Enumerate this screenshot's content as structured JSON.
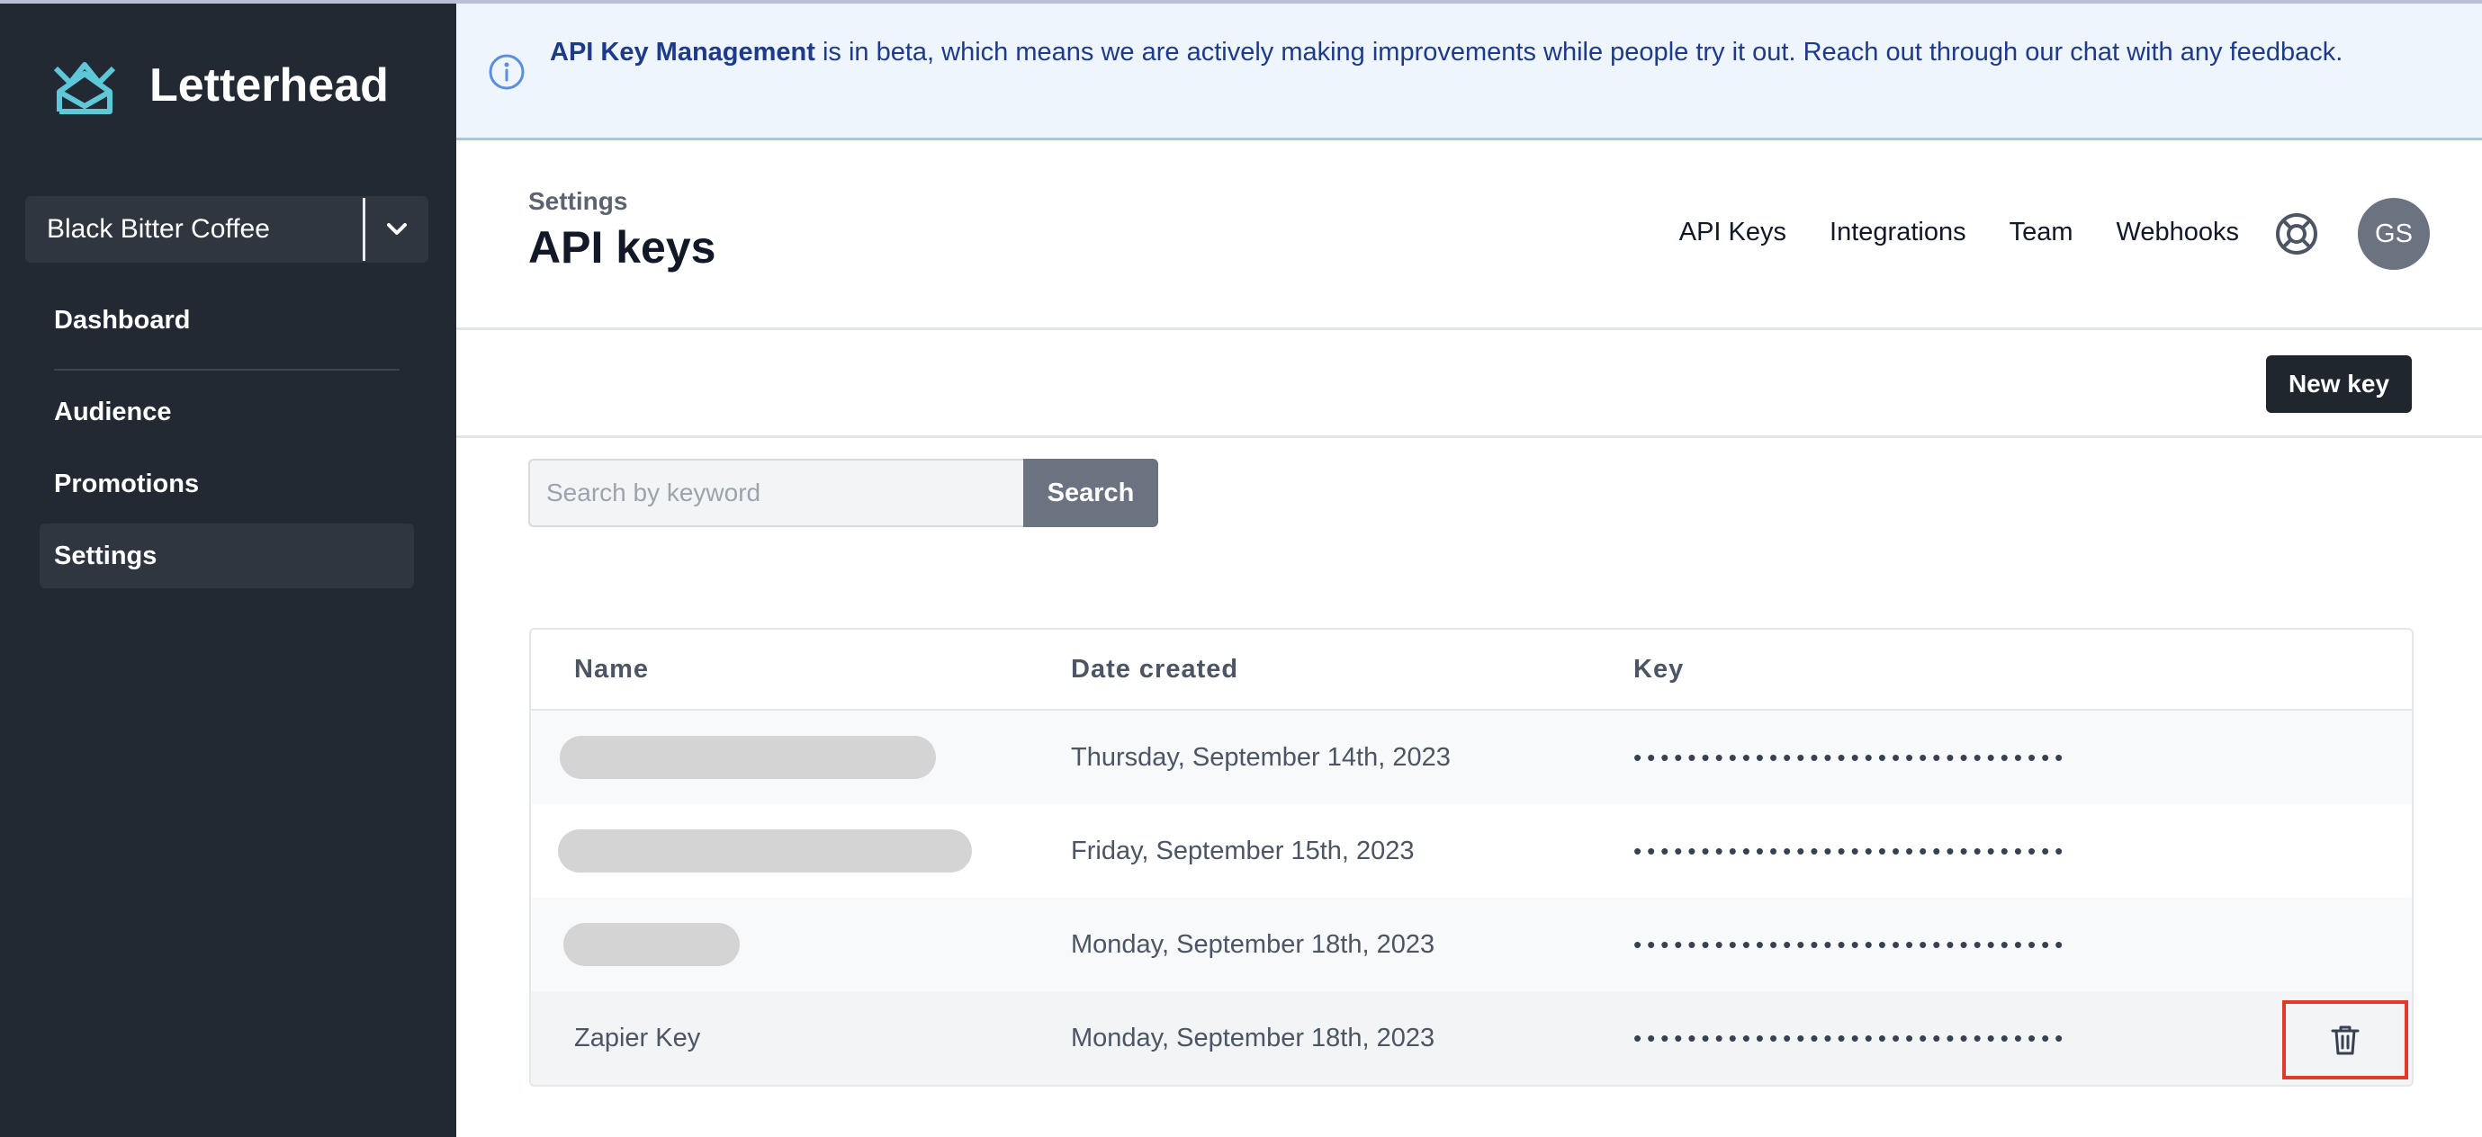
{
  "sidebar": {
    "logo_text": "Letterhead",
    "org": {
      "name": "Black Bitter Coffee"
    },
    "nav": [
      {
        "label": "Dashboard"
      },
      {
        "label": "Audience"
      },
      {
        "label": "Promotions"
      },
      {
        "label": "Settings",
        "active": true
      }
    ]
  },
  "banner": {
    "strong": "API Key Management",
    "text": " is in beta, which means we are actively making improvements while people try it out. Reach out through our chat with any feedback."
  },
  "header": {
    "breadcrumb": "Settings",
    "title": "API keys",
    "nav": [
      "API Keys",
      "Integrations",
      "Team",
      "Webhooks"
    ],
    "avatar_initials": "GS"
  },
  "toolbar": {
    "new_key_label": "New key"
  },
  "search": {
    "placeholder": "Search by keyword",
    "button_label": "Search"
  },
  "table": {
    "columns": [
      "Name",
      "Date created",
      "Key"
    ],
    "rows": [
      {
        "name": "",
        "date": "Thursday, September 14th, 2023",
        "key": "••••••••••••••••••••••••••••••••"
      },
      {
        "name": "",
        "date": "Friday, September 15th, 2023",
        "key": "••••••••••••••••••••••••••••••••"
      },
      {
        "name": "",
        "date": "Monday, September 18th, 2023",
        "key": "••••••••••••••••••••••••••••••••"
      },
      {
        "name": "Zapier Key",
        "date": "Monday, September 18th, 2023",
        "key": "••••••••••••••••••••••••••••••••"
      }
    ]
  },
  "colors": {
    "sidebar_bg": "#222933",
    "banner_bg": "#eef5fd",
    "banner_text": "#1e3a8a",
    "highlight_border": "#e03b2a",
    "logo_teal": "#5ec8d8"
  }
}
